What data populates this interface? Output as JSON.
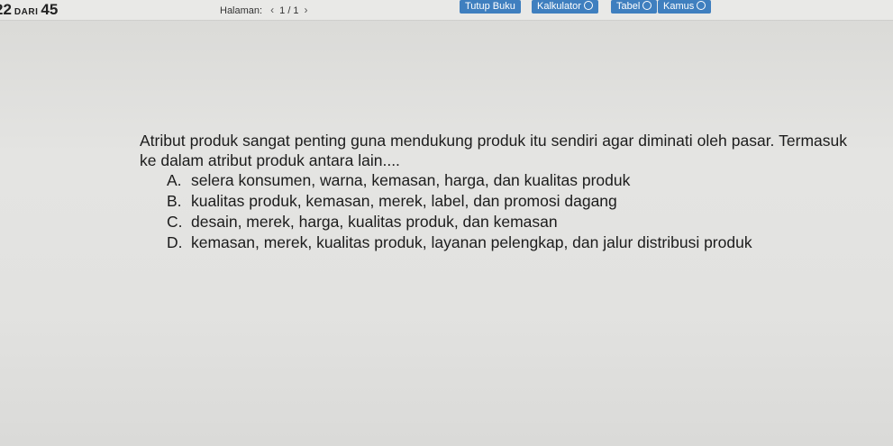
{
  "header": {
    "current_question": "22",
    "of_label": "DARI",
    "total_questions": "45",
    "page_label": "Halaman:",
    "page_value": "1 / 1",
    "prev_arrow": "‹",
    "next_arrow": "›"
  },
  "tools": {
    "close_book": "Tutup Buku",
    "calculator": "Kalkulator",
    "table": "Tabel",
    "dictionary": "Kamus"
  },
  "question": {
    "stem": "Atribut produk sangat penting guna mendukung produk itu sendiri agar diminati oleh pasar. Termasuk ke dalam atribut produk antara lain....",
    "options": [
      {
        "letter": "A.",
        "text": "selera konsumen, warna, kemasan, harga, dan kualitas produk"
      },
      {
        "letter": "B.",
        "text": "kualitas produk, kemasan, merek, label, dan promosi dagang"
      },
      {
        "letter": "C.",
        "text": "desain, merek, harga, kualitas produk, dan kemasan"
      },
      {
        "letter": "D.",
        "text": "kemasan, merek, kualitas produk, layanan pelengkap, dan jalur distribusi produk"
      }
    ]
  },
  "colors": {
    "tool_button_bg": "#3f7fbf",
    "background": "#e2e2e0"
  }
}
